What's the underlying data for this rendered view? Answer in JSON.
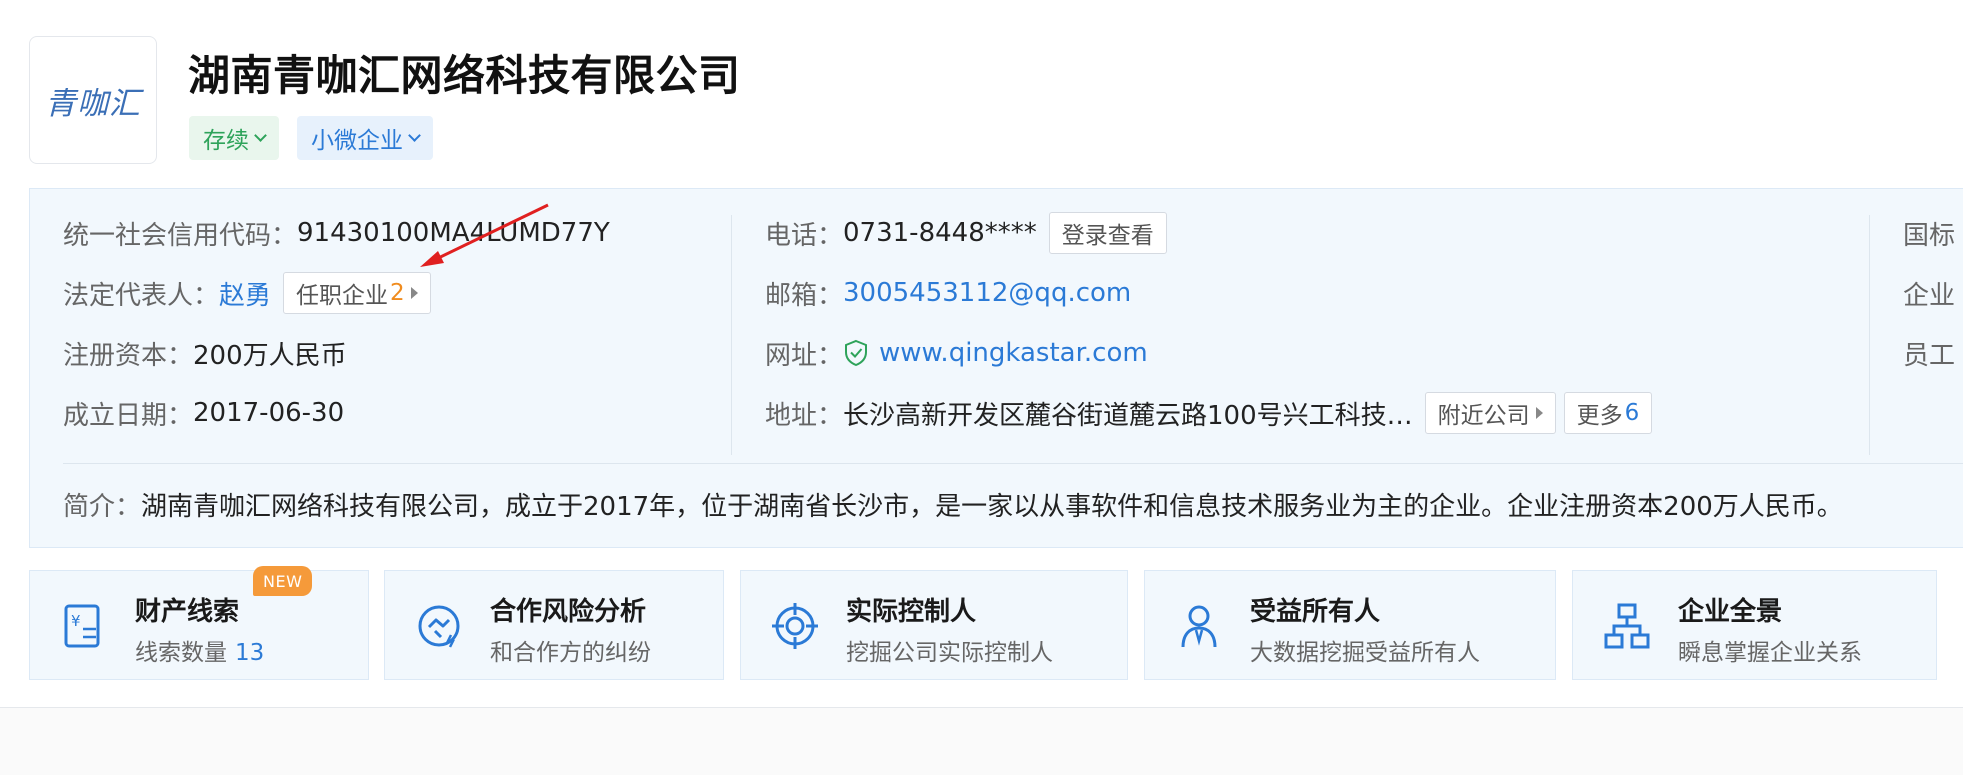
{
  "header": {
    "logo_text": "青咖汇",
    "company_name": "湖南青咖汇网络科技有限公司",
    "tags": [
      {
        "label": "存续"
      },
      {
        "label": "小微企业"
      }
    ]
  },
  "info": {
    "credit_code": {
      "label": "统一社会信用代码：",
      "value": "91430100MA4LUMD77Y"
    },
    "legal_rep": {
      "label": "法定代表人：",
      "value": "赵勇",
      "button_label": "任职企业",
      "button_count": "2"
    },
    "reg_capital": {
      "label": "注册资本：",
      "value": "200万人民币"
    },
    "founded": {
      "label": "成立日期：",
      "value": "2017-06-30"
    },
    "phone": {
      "label": "电话：",
      "value": "0731-8448****",
      "button_label": "登录查看"
    },
    "email": {
      "label": "邮箱：",
      "value": "3005453112@qq.com"
    },
    "website": {
      "label": "网址：",
      "value": "www.qingkastar.com"
    },
    "address": {
      "label": "地址：",
      "value": "长沙高新开发区麓谷街道麓云路100号兴工科技…",
      "nearby_label": "附近公司",
      "more_label": "更多",
      "more_count": "6"
    },
    "right_col": [
      "国标",
      "企业",
      "员工"
    ],
    "description": {
      "label": "简介：",
      "value": "湖南青咖汇网络科技有限公司，成立于2017年，位于湖南省长沙市，是一家以从事软件和信息技术服务业为主的企业。企业注册资本200万人民币。"
    }
  },
  "cards": [
    {
      "title": "财产线索",
      "badge": "NEW",
      "subtitle": "线索数量",
      "count": "13",
      "icon": "clue-icon"
    },
    {
      "title": "合作风险分析",
      "subtitle": "和合作方的纠纷",
      "icon": "handshake-risk-icon"
    },
    {
      "title": "实际控制人",
      "subtitle": "挖掘公司实际控制人",
      "icon": "target-icon"
    },
    {
      "title": "受益所有人",
      "subtitle": "大数据挖掘受益所有人",
      "icon": "person-icon"
    },
    {
      "title": "企业全景",
      "subtitle": "瞬息掌握企业关系",
      "icon": "org-chart-icon"
    }
  ],
  "colors": {
    "accent": "#2b7ad6",
    "status_green": "#2ea35a",
    "badge_orange": "#f59a3a",
    "annotation_red": "#e02020",
    "panel_bg": "#f2f8fd"
  }
}
